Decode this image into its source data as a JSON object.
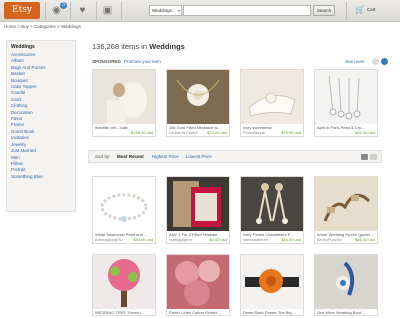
{
  "header": {
    "logo": "Etsy",
    "search_category": "Weddings",
    "search_value": "",
    "search_button": "Search",
    "cart_label": "Cart",
    "notification_count": "3"
  },
  "breadcrumb": "Home > Buy > Categories > Weddings",
  "sidebar": {
    "title": "Weddings",
    "items": [
      "Accessories",
      "Album",
      "Bags And Purses",
      "Basket",
      "Bouquet",
      "Cake Topper",
      "Candle",
      "Card",
      "Clothing",
      "Decoration",
      "Favor",
      "Frame",
      "Guest Book",
      "Invitation",
      "Jewelry",
      "Just Married",
      "Men",
      "Pillow",
      "Portrait",
      "Something Blue"
    ]
  },
  "results": {
    "count": "136,268 items in ",
    "category": "Weddings"
  },
  "sponsored": {
    "label": "SPONSORED",
    "promote": "Promote your item",
    "see_more": "See more"
  },
  "sort": {
    "label": "Sort by:",
    "recent": "Most Recent",
    "highest": "Highest Price",
    "lowest": "Lowest Price"
  },
  "sponsored_items": [
    {
      "title": "mantilla veil - Julie",
      "shop": "",
      "price": "$138.00 usd"
    },
    {
      "title": "18k Gold Filled Necklace w...",
      "shop": "LauraLeeClarke",
      "price": "$22.00 usd"
    },
    {
      "title": "ivory sweetness",
      "shop": "PrichoBizzie",
      "price": "$79.95 usd"
    },
    {
      "title": "April in Paris Pearl & Cry...",
      "shop": "",
      "price": "$22.00 usd"
    }
  ],
  "items_row1": [
    {
      "title": "White Swarovski Pearl and ...",
      "shop": "ArtimaginingTw",
      "price": "$30.00 usd"
    },
    {
      "title": "ANY 3 For 2 Filled Hessian...",
      "shop": "craftygalgem",
      "price": "$3.00 usd"
    },
    {
      "title": "Ivory Pearls Chandeliers E...",
      "shop": "VanessaBrum",
      "price": "$14.00 usd"
    },
    {
      "title": "Wood Wedding Puzzle (guest...",
      "shop": "BeckyPuzzles",
      "price": "$85.00 usd"
    }
  ],
  "items_row2": [
    {
      "title": "WEDDING TREE 'Green I..."
    },
    {
      "title": "Fabric Linen Cotton Flower..."
    },
    {
      "title": "Dress Sash Flower The Big ..."
    },
    {
      "title": "One More Wedding Bout..."
    }
  ],
  "colors": {
    "brand": "#d5641c",
    "link": "#3366aa",
    "price": "#5a9c2e"
  },
  "icons": [
    "bell-icon",
    "heart-icon",
    "box-icon",
    "cart-icon"
  ]
}
